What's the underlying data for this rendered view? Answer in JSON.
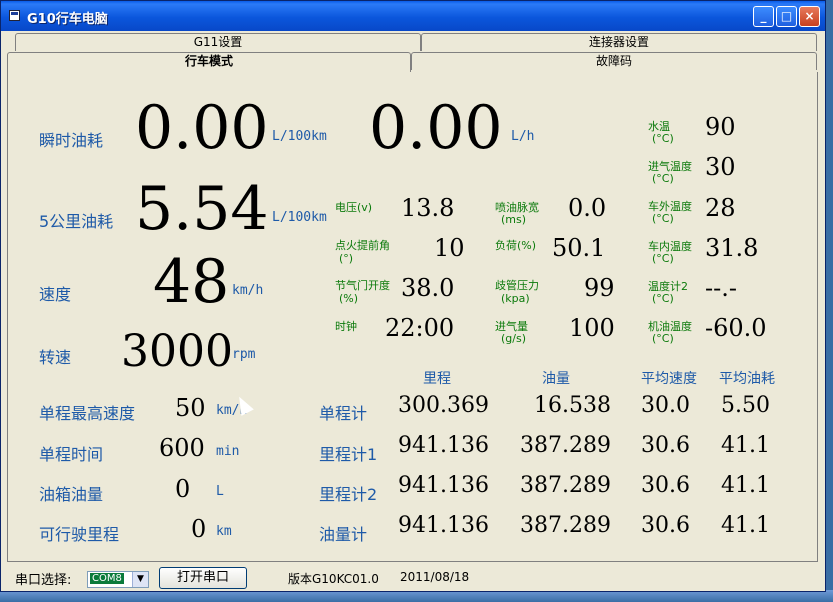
{
  "window": {
    "title": "G10行车电脑"
  },
  "tabs": {
    "g11": "G11设置",
    "connector": "连接器设置",
    "drive": "行车模式",
    "fault": "故障码"
  },
  "main": {
    "instant_label": "瞬时油耗",
    "instant_value": "0.00",
    "instant_unit": "L/100km",
    "instant_lh_value": "0.00",
    "instant_lh_unit": "L/h",
    "km5_label": "5公里油耗",
    "km5_value": "5.54",
    "km5_unit": "L/100km",
    "speed_label": "速度",
    "speed_value": "48",
    "speed_unit": "km/h",
    "rpm_label": "转速",
    "rpm_value": "3000",
    "rpm_unit": "rpm"
  },
  "sensors": {
    "voltage_label": "电压(v)",
    "voltage_value": "13.8",
    "injection_label": "喷油脉宽",
    "injection_unit": "(ms)",
    "injection_value": "0.0",
    "ignition_label": "点火提前角",
    "ignition_unit": "(°)",
    "ignition_value": "10",
    "load_label": "负荷(%)",
    "load_value": "50.1",
    "throttle_label": "节气门开度",
    "throttle_unit": "(%)",
    "throttle_value": "38.0",
    "manifold_label": "歧管压力",
    "manifold_unit": "(kpa)",
    "manifold_value": "99",
    "clock_label": "时钟",
    "clock_value": "22:00",
    "intake_label": "进气量",
    "intake_unit": "(g/s)",
    "intake_value": "100"
  },
  "temps": {
    "water_label": "水温",
    "water_unit": "(°C)",
    "water_value": "90",
    "intake_temp_label": "进气温度",
    "intake_temp_unit": "(°C)",
    "intake_temp_value": "30",
    "outside_label": "车外温度",
    "outside_unit": "(°C)",
    "outside_value": "28",
    "inside_label": "车内温度",
    "inside_unit": "(°C)",
    "inside_value": "31.8",
    "gauge2_label": "温度计2",
    "gauge2_unit": "(°C)",
    "gauge2_value": "--.-",
    "oil_label": "机油温度",
    "oil_unit": "(°C)",
    "oil_value": "-60.0"
  },
  "trip": {
    "max_speed_label": "单程最高速度",
    "max_speed_value": "50",
    "max_speed_unit": "km/h",
    "time_label": "单程时间",
    "time_value": "600",
    "time_unit": "min",
    "fuel_label": "油箱油量",
    "fuel_value": "0",
    "fuel_unit": "L",
    "range_label": "可行驶里程",
    "range_value": "0",
    "range_unit": "km"
  },
  "table": {
    "headers": [
      "里程",
      "油量",
      "平均速度",
      "平均油耗"
    ],
    "rows": [
      {
        "label": "单程计",
        "cells": [
          "300.369",
          "16.538",
          "30.0",
          "5.50"
        ]
      },
      {
        "label": "里程计1",
        "cells": [
          "941.136",
          "387.289",
          "30.6",
          "41.1"
        ]
      },
      {
        "label": "里程计2",
        "cells": [
          "941.136",
          "387.289",
          "30.6",
          "41.1"
        ]
      },
      {
        "label": "油量计",
        "cells": [
          "941.136",
          "387.289",
          "30.6",
          "41.1"
        ]
      }
    ]
  },
  "status": {
    "port_label": "串口选择:",
    "port_value": "COM8",
    "open_button": "打开串口",
    "version": "版本G10KC01.0",
    "date": "2011/08/18"
  },
  "icons": {
    "window": "app-window-icon",
    "combo": "chevron-down-icon",
    "cursor": "mouse-pointer-icon"
  }
}
